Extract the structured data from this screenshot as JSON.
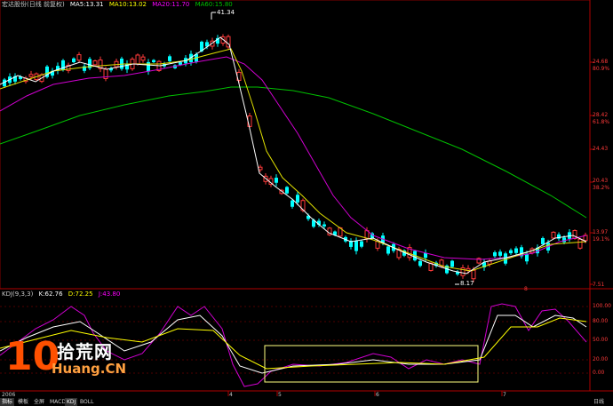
{
  "header": {
    "stock_name": "宏达股份(日线 前复权)",
    "ma5": "MA5:13.31",
    "ma10": "MA10:13.02",
    "ma20": "MA20:11.70",
    "ma60": "MA60:15.80"
  },
  "kdj_header": {
    "name": "KDJ(9,3,3)",
    "k": "K:62.76",
    "d": "D:72.25",
    "j": "J:43.80"
  },
  "price_axis": {
    "levels": [
      "24.68",
      "80.9%",
      "28.42",
      "61.8%",
      "24.43",
      "20.43",
      "38.2%",
      "13.97",
      "19.1%",
      "7.51"
    ]
  },
  "kdj_axis": {
    "levels": [
      "100.00",
      "80.00",
      "50.00",
      "20.00",
      "0.00"
    ]
  },
  "annotations": {
    "high_marker": "41.34",
    "low_marker": "8.17",
    "event_marker": "8"
  },
  "date_axis": [
    "2006",
    "4",
    "5",
    "6",
    "7"
  ],
  "bottom_tabs": [
    "指标",
    "模板",
    "全屏",
    "MACD",
    "KDJ",
    "BOLL"
  ],
  "right_label": "日线",
  "watermark": {
    "number": "10",
    "cn": "拾荒网",
    "url": "Huang.CN"
  },
  "colors": {
    "up": "#ff3a3a",
    "down": "#00ffff",
    "ma5": "#ffffff",
    "ma10": "#ffff00",
    "ma20": "#ff00ff",
    "ma60": "#00c000",
    "border": "#b00000",
    "selection": "#ffff80"
  }
}
